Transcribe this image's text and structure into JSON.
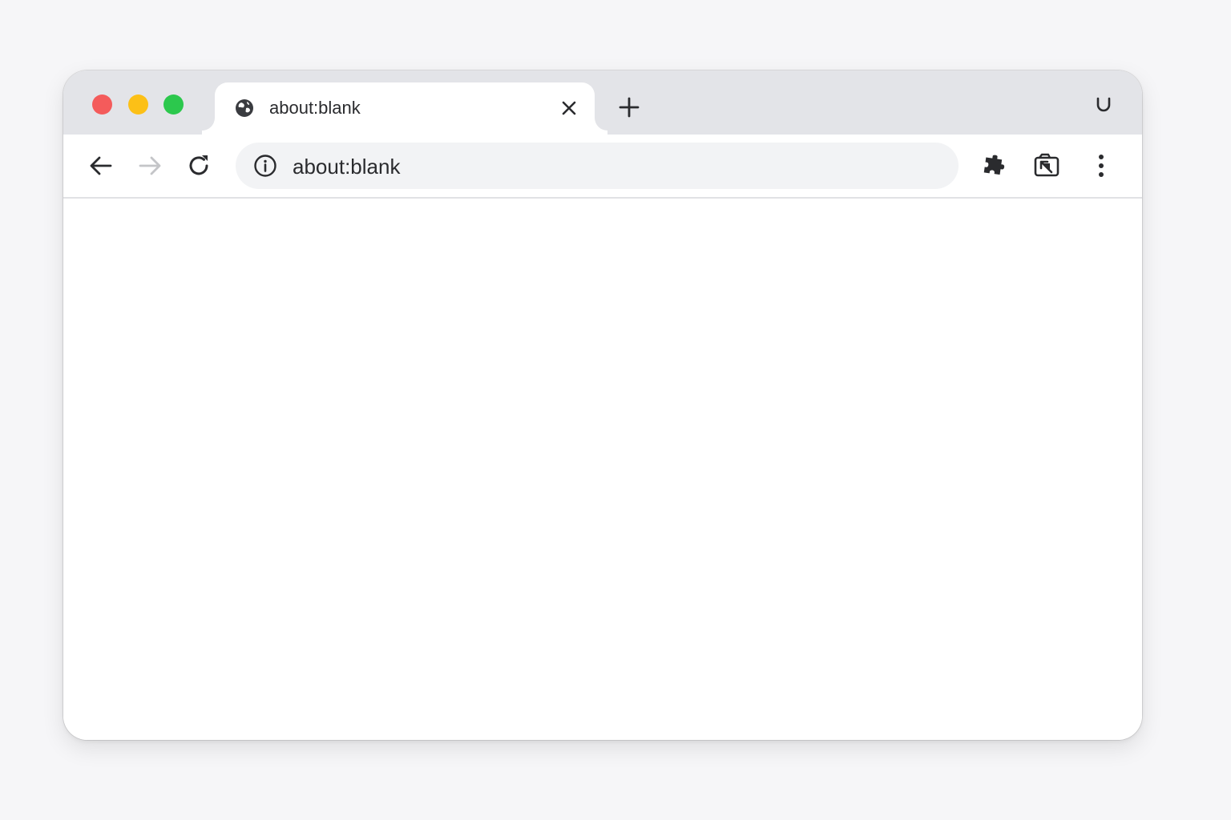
{
  "window": {
    "traffic_lights": {
      "close_color": "#f45b5b",
      "minimize_color": "#fcc017",
      "maximize_color": "#2cc84d"
    }
  },
  "tabs": [
    {
      "title": "about:blank",
      "favicon": "globe-icon",
      "close_icon": "close-icon",
      "active": true
    }
  ],
  "tabstrip": {
    "new_tab_icon": "plus-icon",
    "profile_icon": "profile-icon"
  },
  "toolbar": {
    "back_icon": "arrow-left-icon",
    "forward_icon": "arrow-right-icon",
    "reload_icon": "reload-icon",
    "omnibox": {
      "info_icon": "info-icon",
      "url": "about:blank"
    },
    "extensions_icon": "puzzle-icon",
    "cast_icon": "cast-icon",
    "menu_icon": "kebab-menu-icon"
  },
  "content": {
    "page": "blank"
  }
}
